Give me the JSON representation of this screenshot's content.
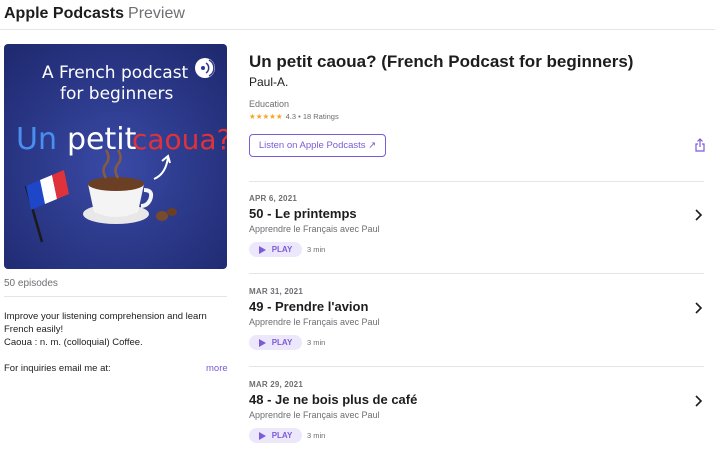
{
  "header": {
    "brand_bold": "Apple Podcasts",
    "brand_light": "Preview"
  },
  "podcast": {
    "cover_text": {
      "line1": "A French podcast",
      "line2": "for beginners",
      "word1": "Un",
      "word2": "petit",
      "word3": "caoua?"
    },
    "title": "Un petit caoua? (French Podcast for beginners)",
    "author": "Paul-A.",
    "category": "Education",
    "stars": "★★★★★",
    "rating_text": "4.3 • 18 Ratings",
    "listen_button": "Listen on Apple Podcasts ↗",
    "episodes_count": "50 episodes",
    "description_lines": [
      "Improve your listening comprehension and learn",
      "French easily!",
      "Caoua : n. m. (colloquial) Coffee."
    ],
    "inquiries": "For inquiries email me at:",
    "more_label": "more"
  },
  "episodes": [
    {
      "date": "APR 6, 2021",
      "title": "50 - Le printemps",
      "subtitle": "Apprendre le Français avec Paul",
      "play_label": "PLAY",
      "duration": "3 min"
    },
    {
      "date": "MAR 31, 2021",
      "title": "49 - Prendre l'avion",
      "subtitle": "Apprendre le Français avec Paul",
      "play_label": "PLAY",
      "duration": "3 min"
    },
    {
      "date": "MAR 29, 2021",
      "title": "48 - Je ne bois plus de café",
      "subtitle": "Apprendre le Français avec Paul",
      "play_label": "PLAY",
      "duration": "3 min"
    }
  ],
  "colors": {
    "accent": "#7b5bd6",
    "cover_bg": "#2d3a8c",
    "star": "#f5a623"
  },
  "icons": {
    "share": "share-icon",
    "play": "play-icon",
    "chevron": "chevron-right-icon",
    "podcast_badge": "podcast-badge-icon"
  }
}
